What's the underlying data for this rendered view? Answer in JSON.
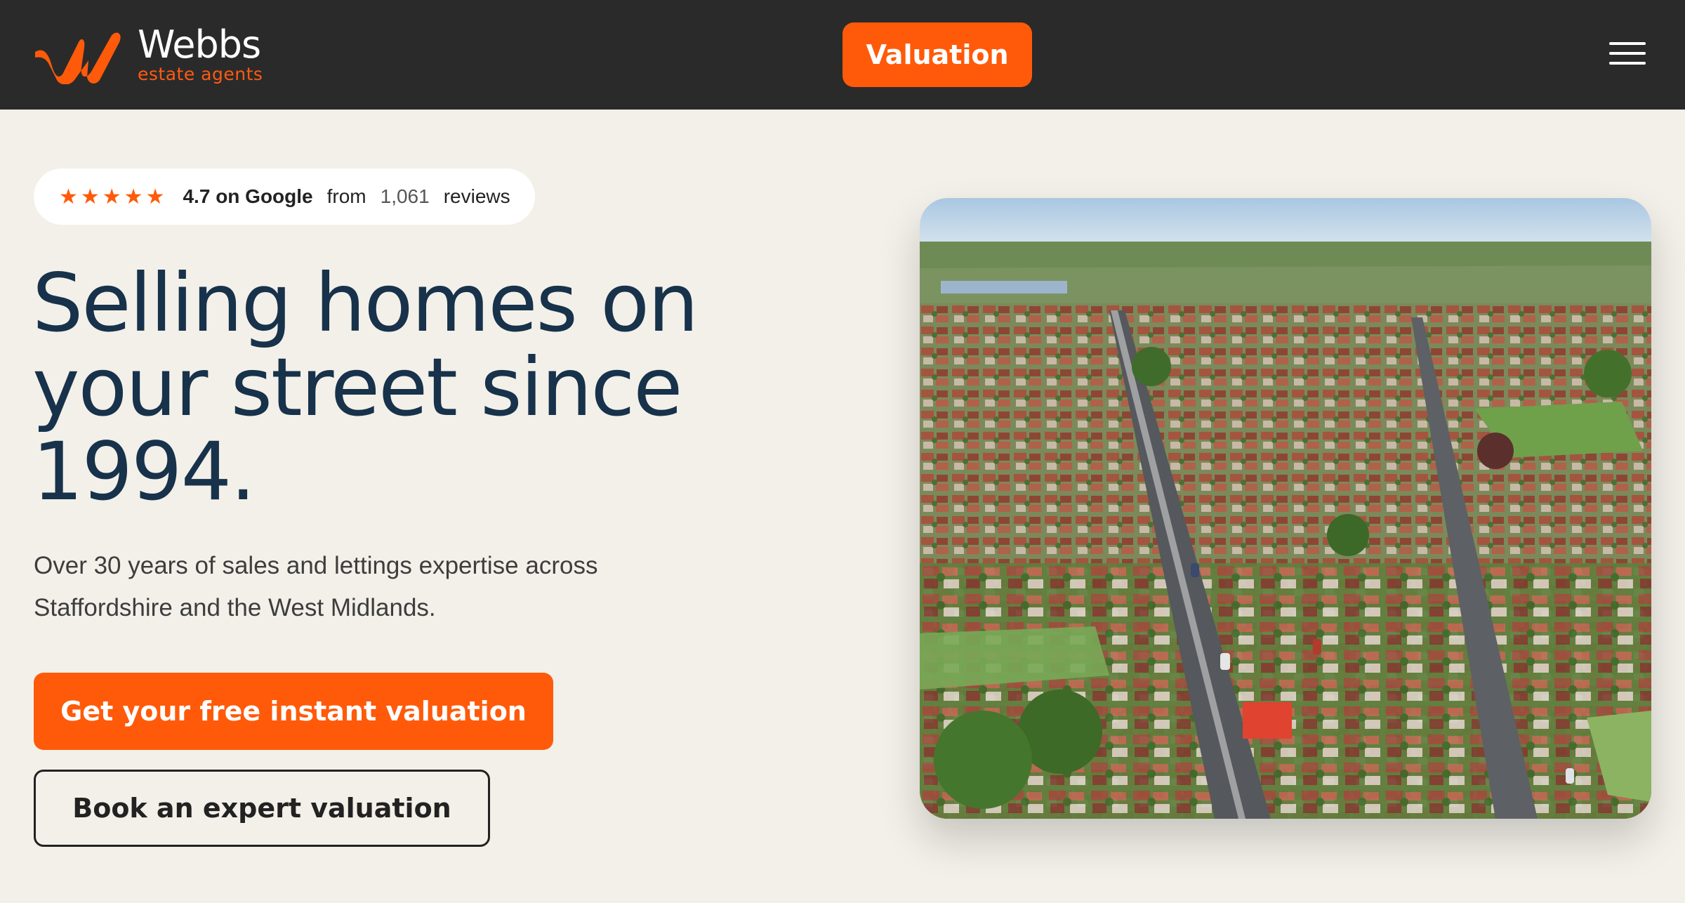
{
  "header": {
    "logo_name": "Webbs",
    "logo_subtitle": "estate agents",
    "valuation_label": "Valuation",
    "menu_icon": "hamburger-menu-icon"
  },
  "rating": {
    "stars_icon": "five-stars-icon",
    "stars": "★★★★★",
    "score_label": "4.7 on Google",
    "from_label": "from",
    "count": "1,061",
    "reviews_label": "reviews"
  },
  "hero": {
    "headline": "Selling homes on your street since 1994.",
    "subtext": "Over 30 years of sales and lettings expertise across Staffordshire and the West Midlands.",
    "primary_cta": "Get your free instant valuation",
    "secondary_cta": "Book an expert valuation"
  },
  "colors": {
    "accent": "#ff5a0a",
    "header_bg": "#2a2a2a",
    "page_bg": "#f3f0e9",
    "headline": "#17324a"
  }
}
